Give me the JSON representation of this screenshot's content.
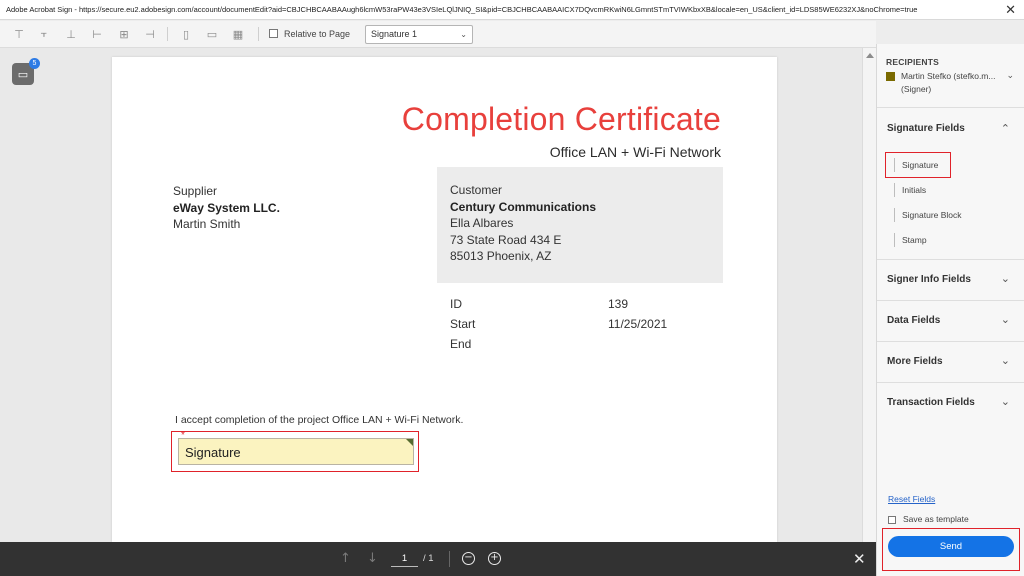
{
  "titlebar": {
    "text": "Adobe Acrobat Sign - https://secure.eu2.adobesign.com/account/documentEdit?aid=CBJCHBCAABAAugh6lcmW53raPW43e3VSIeLQlJNIQ_SI&pid=CBJCHBCAABAAICX7DQvcmRKwiN6LGmntSTmTVIWKbxXB&locale=en_US&client_id=LDS85WE6232XJ&noChrome=true",
    "close_glyph": "✕"
  },
  "toolbar": {
    "relative_label": "Relative to Page",
    "select_value": "Signature 1",
    "select_caret": "⌄",
    "icons": [
      "align-top-icon",
      "align-middle-icon",
      "align-bottom-icon",
      "align-left-icon",
      "align-center-icon",
      "align-right-icon",
      "distribute-horizontal-icon",
      "distribute-vertical-icon",
      "grid-icon"
    ]
  },
  "comments": {
    "icon": "comment-icon",
    "glyph": "▭",
    "badge": "5"
  },
  "document": {
    "title": "Completion Certificate",
    "subtitle": "Office LAN + Wi-Fi Network",
    "supplier": {
      "label": "Supplier",
      "company": "eWay System LLC.",
      "person": "Martin Smith"
    },
    "customer": {
      "label": "Customer",
      "company": "Century Communications",
      "person": "Ella Albares",
      "address1": "73 State Road 434 E",
      "address2": "85013 Phoenix, AZ"
    },
    "meta": {
      "id_label": "ID",
      "id_value": "139",
      "start_label": "Start",
      "start_value": "11/25/2021",
      "end_label": "End"
    },
    "accept_text": "I accept completion of the project Office LAN + Wi-Fi Network.",
    "signature_field": {
      "label": "Signature",
      "required_mark": "*"
    }
  },
  "bottombar": {
    "prev_glyph": "↑",
    "next_glyph": "↓",
    "page_current": "1",
    "page_total": "/ 1",
    "zoom_out_glyph": "−",
    "zoom_in_glyph": "+",
    "close_glyph": "✕"
  },
  "panel": {
    "recipients_heading": "RECIPIENTS",
    "recipient_name": "Martin Stefko (stefko.m...",
    "recipient_role": "(Signer)",
    "recipient_color": "#7a6a00",
    "chevron_down": "⌄",
    "chevron_up": "⌃",
    "sections": {
      "signature_fields": "Signature Fields",
      "signer_info_fields": "Signer Info Fields",
      "data_fields": "Data Fields",
      "more_fields": "More Fields",
      "transaction_fields": "Transaction Fields"
    },
    "signature_items": [
      "Signature",
      "Initials",
      "Signature Block",
      "Stamp"
    ],
    "reset_label": "Reset Fields",
    "save_template_label": "Save as template",
    "send_label": "Send"
  },
  "colors": {
    "accent_blue": "#1473e6",
    "title_red": "#e8403c",
    "highlight_red": "#e0222a",
    "signature_fill": "#fbf3c0"
  }
}
